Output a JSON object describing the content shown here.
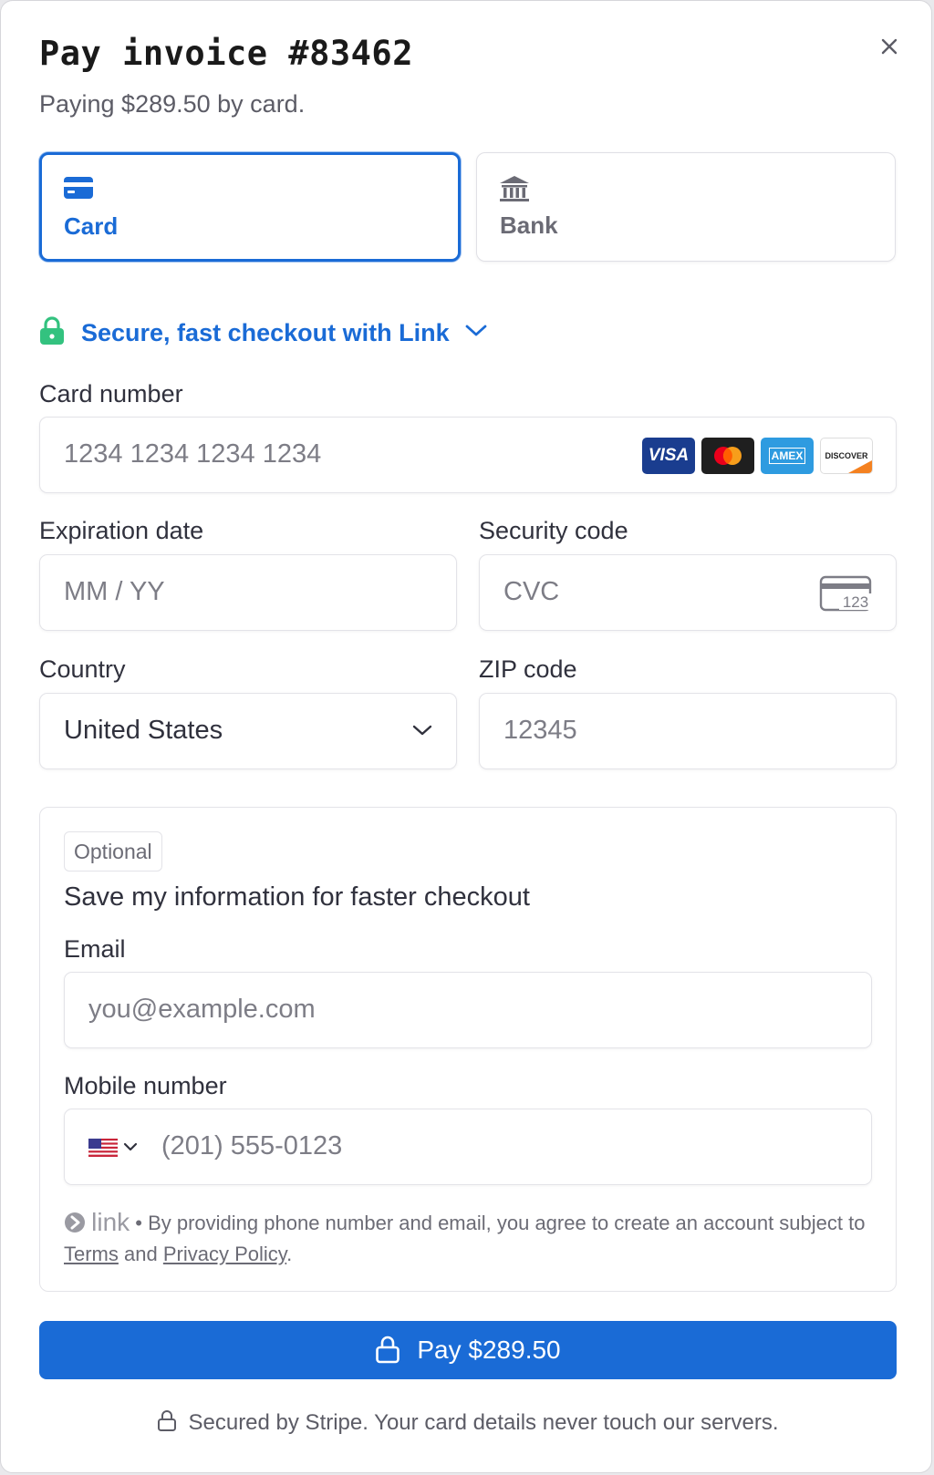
{
  "header": {
    "title": "Pay invoice #83462",
    "subtitle": "Paying $289.50 by card."
  },
  "methods": {
    "card": "Card",
    "bank": "Bank",
    "selected": "Card"
  },
  "link_checkout": {
    "label": "Secure, fast checkout with Link"
  },
  "card_number": {
    "label": "Card number",
    "placeholder": "1234 1234 1234 1234",
    "brands": [
      "VISA",
      "Mastercard",
      "AMEX",
      "DISCOVER"
    ]
  },
  "expiration": {
    "label": "Expiration date",
    "placeholder": "MM / YY"
  },
  "security_code": {
    "label": "Security code",
    "placeholder": "CVC",
    "icon_text": "123"
  },
  "country": {
    "label": "Country",
    "value": "United States"
  },
  "zip": {
    "label": "ZIP code",
    "placeholder": "12345"
  },
  "save_info": {
    "badge": "Optional",
    "title": "Save my information for faster checkout",
    "email_label": "Email",
    "email_placeholder": "you@example.com",
    "mobile_label": "Mobile number",
    "mobile_placeholder": "(201) 555-0123",
    "legal_logo": "link",
    "legal_text": "• By providing phone number and email, you agree to create an account subject to",
    "terms": "Terms",
    "and": "and",
    "privacy": "Privacy Policy",
    "period": "."
  },
  "pay_button": {
    "label": "Pay $289.50"
  },
  "footer": {
    "text": "Secured by Stripe. Your card details never touch our servers."
  },
  "colors": {
    "accent": "#1a6bd6",
    "lock_green": "#33c27f"
  }
}
